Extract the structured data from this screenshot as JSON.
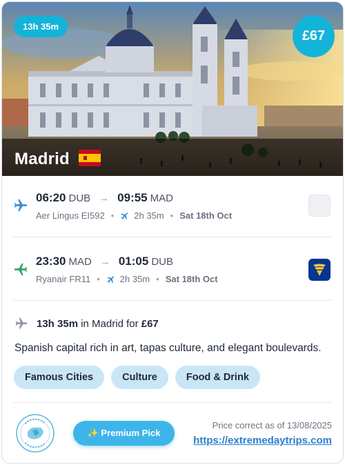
{
  "hero": {
    "duration_badge": "13h 35m",
    "price": "£67",
    "city": "Madrid",
    "image_icon": "madrid-cathedral-photo",
    "flag_icon": "spain-flag-icon"
  },
  "outbound": {
    "dep_time": "06:20",
    "dep_code": "DUB",
    "arrow": "→",
    "arr_time": "09:55",
    "arr_code": "MAD",
    "airline": "Aer Lingus EI592",
    "duration": "2h 35m",
    "date": "Sat 18th Oct",
    "icon_color": "#3a8fd6",
    "logo_icon": "aer-lingus-logo-placeholder"
  },
  "return": {
    "dep_time": "23:30",
    "dep_code": "MAD",
    "arrow": "→",
    "arr_time": "01:05",
    "arr_code": "DUB",
    "airline": "Ryanair FR11",
    "duration": "2h 35m",
    "date": "Sat 18th Oct",
    "icon_color": "#2fa66a",
    "logo_icon": "ryanair-logo-icon"
  },
  "stay": {
    "duration": "13h 35m",
    "in_text": " in Madrid for ",
    "price": "£67"
  },
  "description": "Spanish capital rich in art, tapas culture, and elegant boulevards.",
  "tags": [
    "Famous Cities",
    "Culture",
    "Food & Drink"
  ],
  "footer": {
    "premium_label": "✨ Premium Pick",
    "price_note": "Price correct as of 13/08/2025",
    "site_link": "https://extremedaytrips.com",
    "logo_icon": "extreme-day-trips-logo"
  },
  "colors": {
    "accent": "#14b4d8",
    "tag_bg": "#c9e6f7",
    "link": "#2b7fd0"
  }
}
